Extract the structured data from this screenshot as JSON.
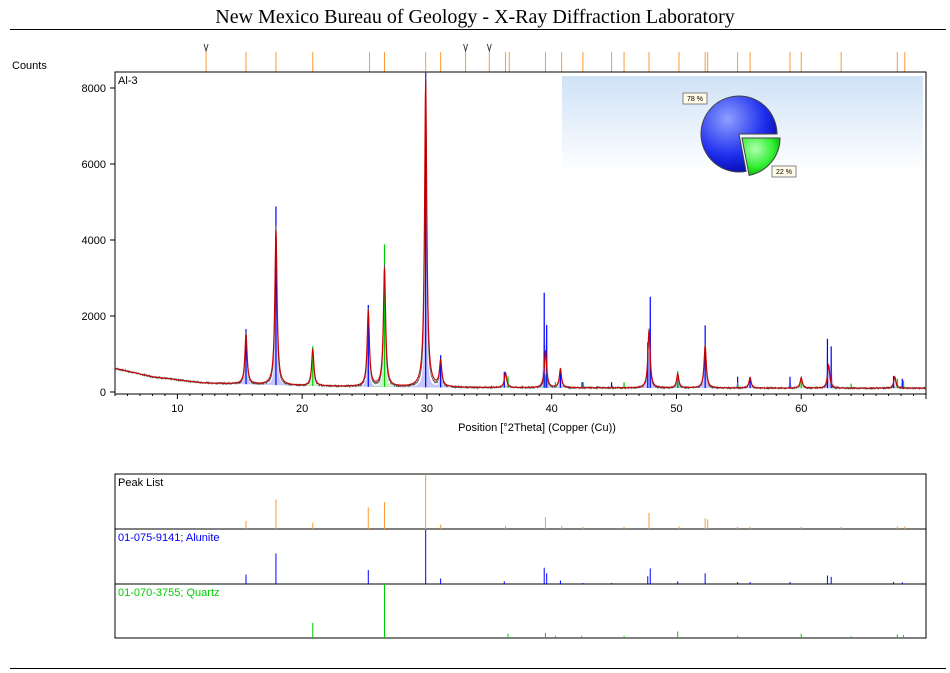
{
  "header": {
    "title": "New Mexico Bureau of Geology - X-Ray Diffraction Laboratory"
  },
  "colors": {
    "alunite": "#0000ff",
    "quartz": "#00cc00",
    "peaks": "#ff9933",
    "calc": "#cc0000",
    "observed": "#505050"
  },
  "chart_data": {
    "type": "line",
    "sample_label": "Al-3",
    "ylabel": "Counts",
    "xlabel": "Position [°2Theta] (Copper (Cu))",
    "xlim": [
      5,
      70
    ],
    "ylim": [
      0,
      8000
    ],
    "xticks": [
      10,
      20,
      30,
      40,
      50,
      60
    ],
    "yticks": [
      0,
      2000,
      4000,
      6000,
      8000
    ],
    "baseline": [
      [
        5,
        620
      ],
      [
        8,
        400
      ],
      [
        12,
        240
      ],
      [
        20,
        160
      ],
      [
        30,
        120
      ],
      [
        40,
        110
      ],
      [
        60,
        100
      ],
      [
        70,
        100
      ]
    ],
    "series": [
      {
        "name": "01-075-9141; Alunite",
        "color": "#0000ff",
        "peaks": [
          [
            15.5,
            1450
          ],
          [
            17.9,
            4700
          ],
          [
            25.3,
            2150
          ],
          [
            29.9,
            8300
          ],
          [
            31.1,
            850
          ],
          [
            36.2,
            420
          ],
          [
            39.4,
            2500
          ],
          [
            39.6,
            1650
          ],
          [
            40.7,
            520
          ],
          [
            42.5,
            150
          ],
          [
            44.8,
            150
          ],
          [
            47.7,
            1200
          ],
          [
            47.9,
            2400
          ],
          [
            50.1,
            400
          ],
          [
            52.3,
            1650
          ],
          [
            54.9,
            300
          ],
          [
            55.9,
            300
          ],
          [
            59.1,
            300
          ],
          [
            62.1,
            1300
          ],
          [
            62.4,
            1100
          ],
          [
            67.4,
            320
          ],
          [
            68.1,
            250
          ]
        ]
      },
      {
        "name": "01-070-3755; Quartz",
        "color": "#00cc00",
        "peaks": [
          [
            20.85,
            1050
          ],
          [
            26.6,
            3750
          ],
          [
            36.5,
            300
          ],
          [
            39.5,
            350
          ],
          [
            40.3,
            150
          ],
          [
            42.4,
            150
          ],
          [
            45.8,
            150
          ],
          [
            50.1,
            450
          ],
          [
            54.9,
            150
          ],
          [
            60.0,
            300
          ],
          [
            64.0,
            120
          ],
          [
            67.7,
            250
          ],
          [
            68.2,
            200
          ]
        ]
      }
    ],
    "calculated_peaks": [
      [
        15.5,
        1350
      ],
      [
        17.9,
        4200
      ],
      [
        20.85,
        1000
      ],
      [
        25.3,
        2050
      ],
      [
        26.6,
        3200
      ],
      [
        29.9,
        8300
      ],
      [
        31.1,
        700
      ],
      [
        36.3,
        400
      ],
      [
        39.5,
        1000
      ],
      [
        40.7,
        500
      ],
      [
        47.8,
        1550
      ],
      [
        50.1,
        380
      ],
      [
        52.3,
        1150
      ],
      [
        55.9,
        280
      ],
      [
        60.0,
        280
      ],
      [
        62.2,
        620
      ],
      [
        67.5,
        300
      ]
    ],
    "marker_ticks": [
      12.3,
      15.5,
      17.9,
      20.85,
      25.4,
      26.6,
      29.9,
      31.1,
      33.1,
      35.0,
      36.3,
      36.6,
      39.5,
      40.8,
      42.5,
      44.8,
      45.8,
      47.8,
      50.2,
      52.3,
      52.5,
      54.9,
      55.9,
      59.1,
      60.0,
      63.2,
      67.7,
      68.3
    ],
    "peak_list": [
      [
        15.5,
        0.15
      ],
      [
        17.9,
        0.55
      ],
      [
        20.85,
        0.12
      ],
      [
        25.3,
        0.4
      ],
      [
        26.6,
        0.5
      ],
      [
        29.9,
        1.0
      ],
      [
        31.1,
        0.08
      ],
      [
        36.3,
        0.06
      ],
      [
        39.5,
        0.22
      ],
      [
        40.8,
        0.06
      ],
      [
        42.5,
        0.04
      ],
      [
        45.8,
        0.04
      ],
      [
        47.8,
        0.3
      ],
      [
        50.2,
        0.05
      ],
      [
        52.3,
        0.2
      ],
      [
        52.5,
        0.18
      ],
      [
        54.9,
        0.04
      ],
      [
        55.9,
        0.04
      ],
      [
        60.0,
        0.04
      ],
      [
        63.2,
        0.04
      ],
      [
        67.7,
        0.05
      ],
      [
        68.3,
        0.05
      ]
    ],
    "pie": {
      "slices": [
        {
          "label": "78 %",
          "value": 78,
          "color": "#0000ff"
        },
        {
          "label": "22 %",
          "value": 22,
          "color": "#00cc00"
        }
      ]
    },
    "lanes": {
      "peak_list_label": "Peak List"
    }
  }
}
